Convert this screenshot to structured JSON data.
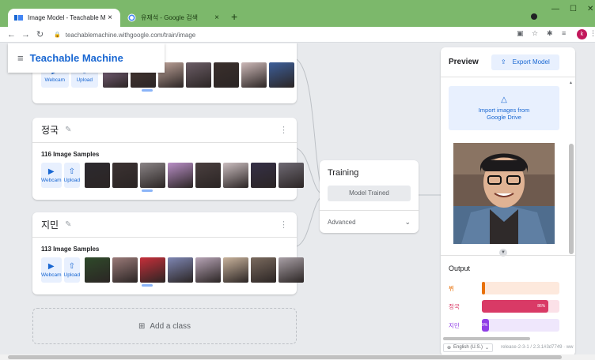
{
  "browser": {
    "tabs": [
      {
        "title": "Image Model - Teachable Machi",
        "active": true
      },
      {
        "title": "유재석 - Google 검색",
        "active": false
      }
    ],
    "new_tab_glyph": "+",
    "url": "teachablemachine.withgoogle.com/train/image",
    "profile_initial": "k"
  },
  "app": {
    "brand": "Teachable Machine"
  },
  "classes": [
    {
      "name": "",
      "samples_label": "",
      "webcam_label": "Webcam",
      "upload_label": "Upload",
      "thumb_colors": [
        "#8b6f8e",
        "#4b3a36",
        "#bfa49a",
        "#6b5d66",
        "#3a2f2c",
        "#cdb9b8",
        "#3d5f9a"
      ]
    },
    {
      "name": "정국",
      "samples_label": "116 Image Samples",
      "webcam_label": "Webcam",
      "upload_label": "Upload",
      "thumb_colors": [
        "#2d2a2f",
        "#3b3232",
        "#8a8486",
        "#b98fc7",
        "#4a3f3f",
        "#cbbec0",
        "#353047",
        "#6f6a74"
      ]
    },
    {
      "name": "지민",
      "samples_label": "113 Image Samples",
      "webcam_label": "Webcam",
      "upload_label": "Upload",
      "thumb_colors": [
        "#2f4a2a",
        "#9a7a78",
        "#c62f3a",
        "#7e86b3",
        "#b7a4b6",
        "#c9b39c",
        "#7a6a5e",
        "#a9a0a6"
      ]
    }
  ],
  "add_class_label": "Add a class",
  "training": {
    "title": "Training",
    "status_label": "Model Trained",
    "advanced_label": "Advanced"
  },
  "preview": {
    "title": "Preview",
    "export_label": "Export Model",
    "drive_label_line1": "Import images from",
    "drive_label_line2": "Google Drive",
    "output_label": "Output",
    "outputs": [
      {
        "label": "뷔",
        "percent": 4,
        "percent_text": "",
        "color": "#e8710a",
        "track": "#fde9dd"
      },
      {
        "label": "정국",
        "percent": 86,
        "percent_text": "86%",
        "color": "#d93a66",
        "track": "#fbe1e8"
      },
      {
        "label": "지민",
        "percent": 9,
        "percent_text": "9%",
        "color": "#8f3ee6",
        "track": "#efe7fc"
      }
    ]
  },
  "footer": {
    "language": "English (U.S.)",
    "release": "release-2-3-1 / 2.3.1#3d7749 · ww"
  }
}
